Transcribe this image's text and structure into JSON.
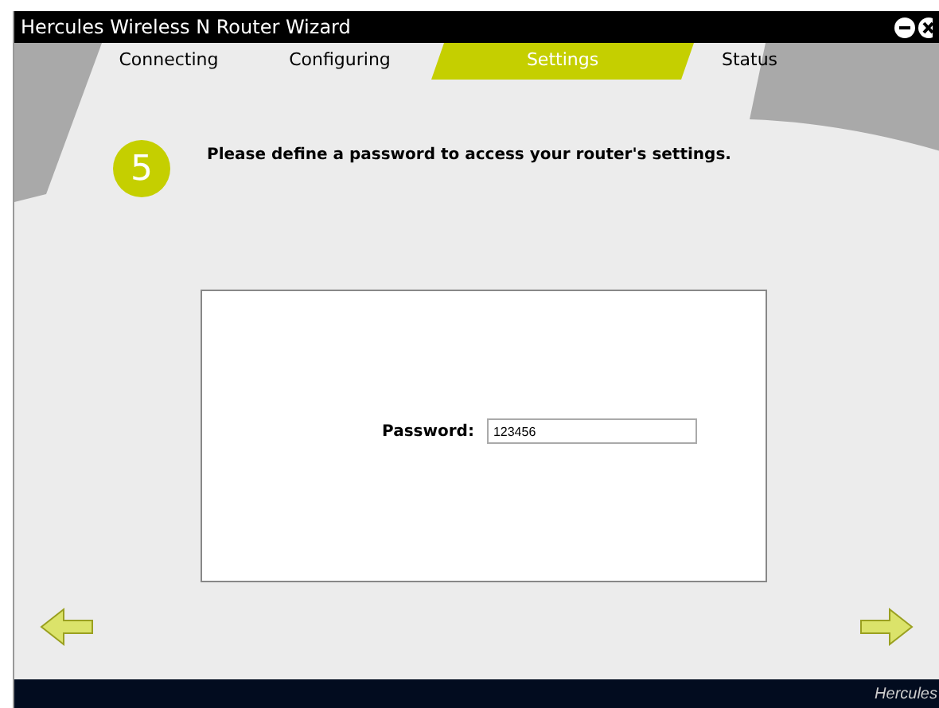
{
  "window": {
    "title": "Hercules Wireless N Router Wizard"
  },
  "tabs": [
    {
      "label": "Connecting",
      "selected": false
    },
    {
      "label": "Configuring",
      "selected": false
    },
    {
      "label": "Settings",
      "selected": true
    },
    {
      "label": "Status",
      "selected": false
    }
  ],
  "step": {
    "number": "5",
    "instruction": "Please define a password to access your router's settings."
  },
  "form": {
    "label": "Password:",
    "value": "123456"
  },
  "footer": {
    "brand": "Hercules"
  }
}
